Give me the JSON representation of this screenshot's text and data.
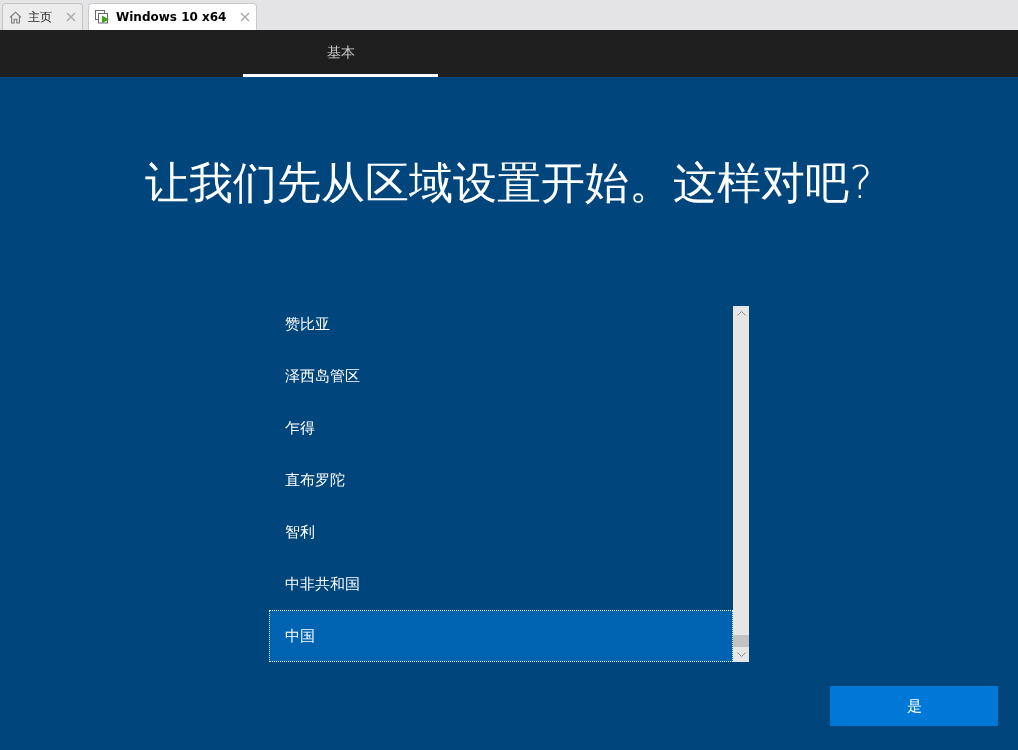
{
  "browser_tabs": [
    {
      "label": "主页",
      "kind": "home",
      "selected": false
    },
    {
      "label": "Windows 10 x64",
      "kind": "vm",
      "selected": true
    }
  ],
  "nav_tabs": [
    {
      "label": "基本",
      "selected": true
    }
  ],
  "heading": "让我们先从区域设置开始。这样对吧?",
  "regions": [
    {
      "label": "赞比亚",
      "selected": false
    },
    {
      "label": "泽西岛管区",
      "selected": false
    },
    {
      "label": "乍得",
      "selected": false
    },
    {
      "label": "直布罗陀",
      "selected": false
    },
    {
      "label": "智利",
      "selected": false
    },
    {
      "label": "中非共和国",
      "selected": false
    },
    {
      "label": "中国",
      "selected": true
    }
  ],
  "buttons": [
    {
      "label": "是"
    }
  ]
}
